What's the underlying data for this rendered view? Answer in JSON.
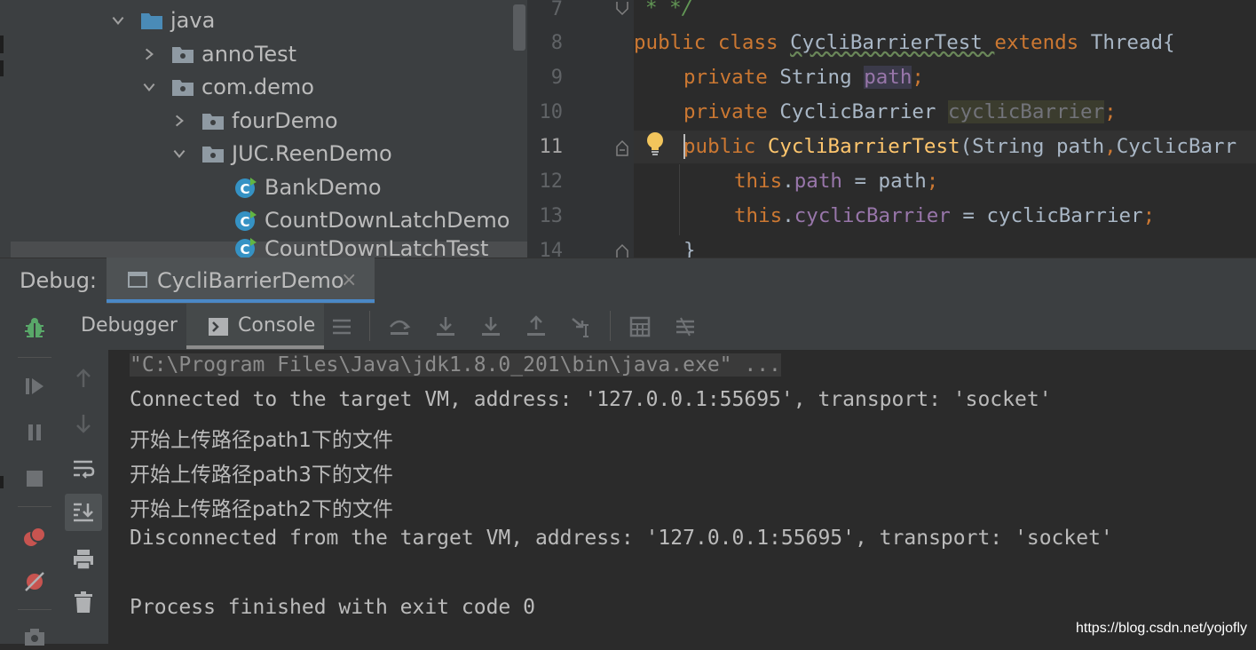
{
  "project_tree": {
    "items": [
      {
        "label": "java",
        "expanded": true,
        "icon": "source-folder-icon"
      },
      {
        "label": "annoTest",
        "expanded": false,
        "icon": "package-icon"
      },
      {
        "label": "com.demo",
        "expanded": true,
        "icon": "package-icon"
      },
      {
        "label": "fourDemo",
        "expanded": false,
        "icon": "package-icon"
      },
      {
        "label": "JUC.ReenDemo",
        "expanded": true,
        "icon": "package-icon"
      },
      {
        "label": "BankDemo",
        "icon": "java-class-icon"
      },
      {
        "label": "CountDownLatchDemo",
        "icon": "java-class-icon"
      },
      {
        "label": "CountDownLatchTest",
        "icon": "java-class-icon"
      }
    ]
  },
  "editor": {
    "line_numbers": [
      "7",
      "8",
      "9",
      "10",
      "11",
      "12",
      "13",
      "14"
    ],
    "current_line": "11",
    "lines": {
      "l7_comment": "* */",
      "l8_kw1": "public class ",
      "l8_name": "CycliBarrierTest ",
      "l8_kw2": "extends ",
      "l8_super": "Thread{",
      "l9_kw": "private ",
      "l9_type": "String ",
      "l9_field": "path",
      "l9_semi": ";",
      "l10_kw": "private ",
      "l10_type": "CyclicBarrier ",
      "l10_field": "cyclicBarrier",
      "l10_semi": ";",
      "l11_kw": "public ",
      "l11_name": "CycliBarrierTest",
      "l11_params": "(String path",
      "l11_comma": ",",
      "l11_rest": "CyclicBarr",
      "l12_this": "this",
      "l12_dot": ".",
      "l12_field": "path",
      "l12_rest": " = path",
      "l12_semi": ";",
      "l13_this": "this",
      "l13_dot": ".",
      "l13_field": "cyclicBarrier",
      "l13_rest": " = cyclicBarrier",
      "l13_semi": ";",
      "l14_brace": "}"
    }
  },
  "debug": {
    "label": "Debug:",
    "session_tab": "CycliBarrierDemo",
    "close_glyph": "×",
    "tabs": {
      "debugger": "Debugger",
      "console": "Console"
    }
  },
  "console": {
    "lines": [
      "\"C:\\Program Files\\Java\\jdk1.8.0_201\\bin\\java.exe\" ...",
      "Connected to the target VM, address: '127.0.0.1:55695', transport: 'socket'",
      "开始上传路径path1下的文件",
      "开始上传路径path3下的文件",
      "开始上传路径path2下的文件",
      "Disconnected from the target VM, address: '127.0.0.1:55695', transport: 'socket'",
      "",
      "Process finished with exit code 0"
    ]
  },
  "watermark": "https://blog.csdn.net/yojofly",
  "colors": {
    "keyword": "#cc7832",
    "field": "#9876aa",
    "method": "#ffc66d",
    "comment": "#629755",
    "accent": "#4a88c7",
    "debug_bug": "#59a869",
    "stop_red": "#c75450"
  }
}
